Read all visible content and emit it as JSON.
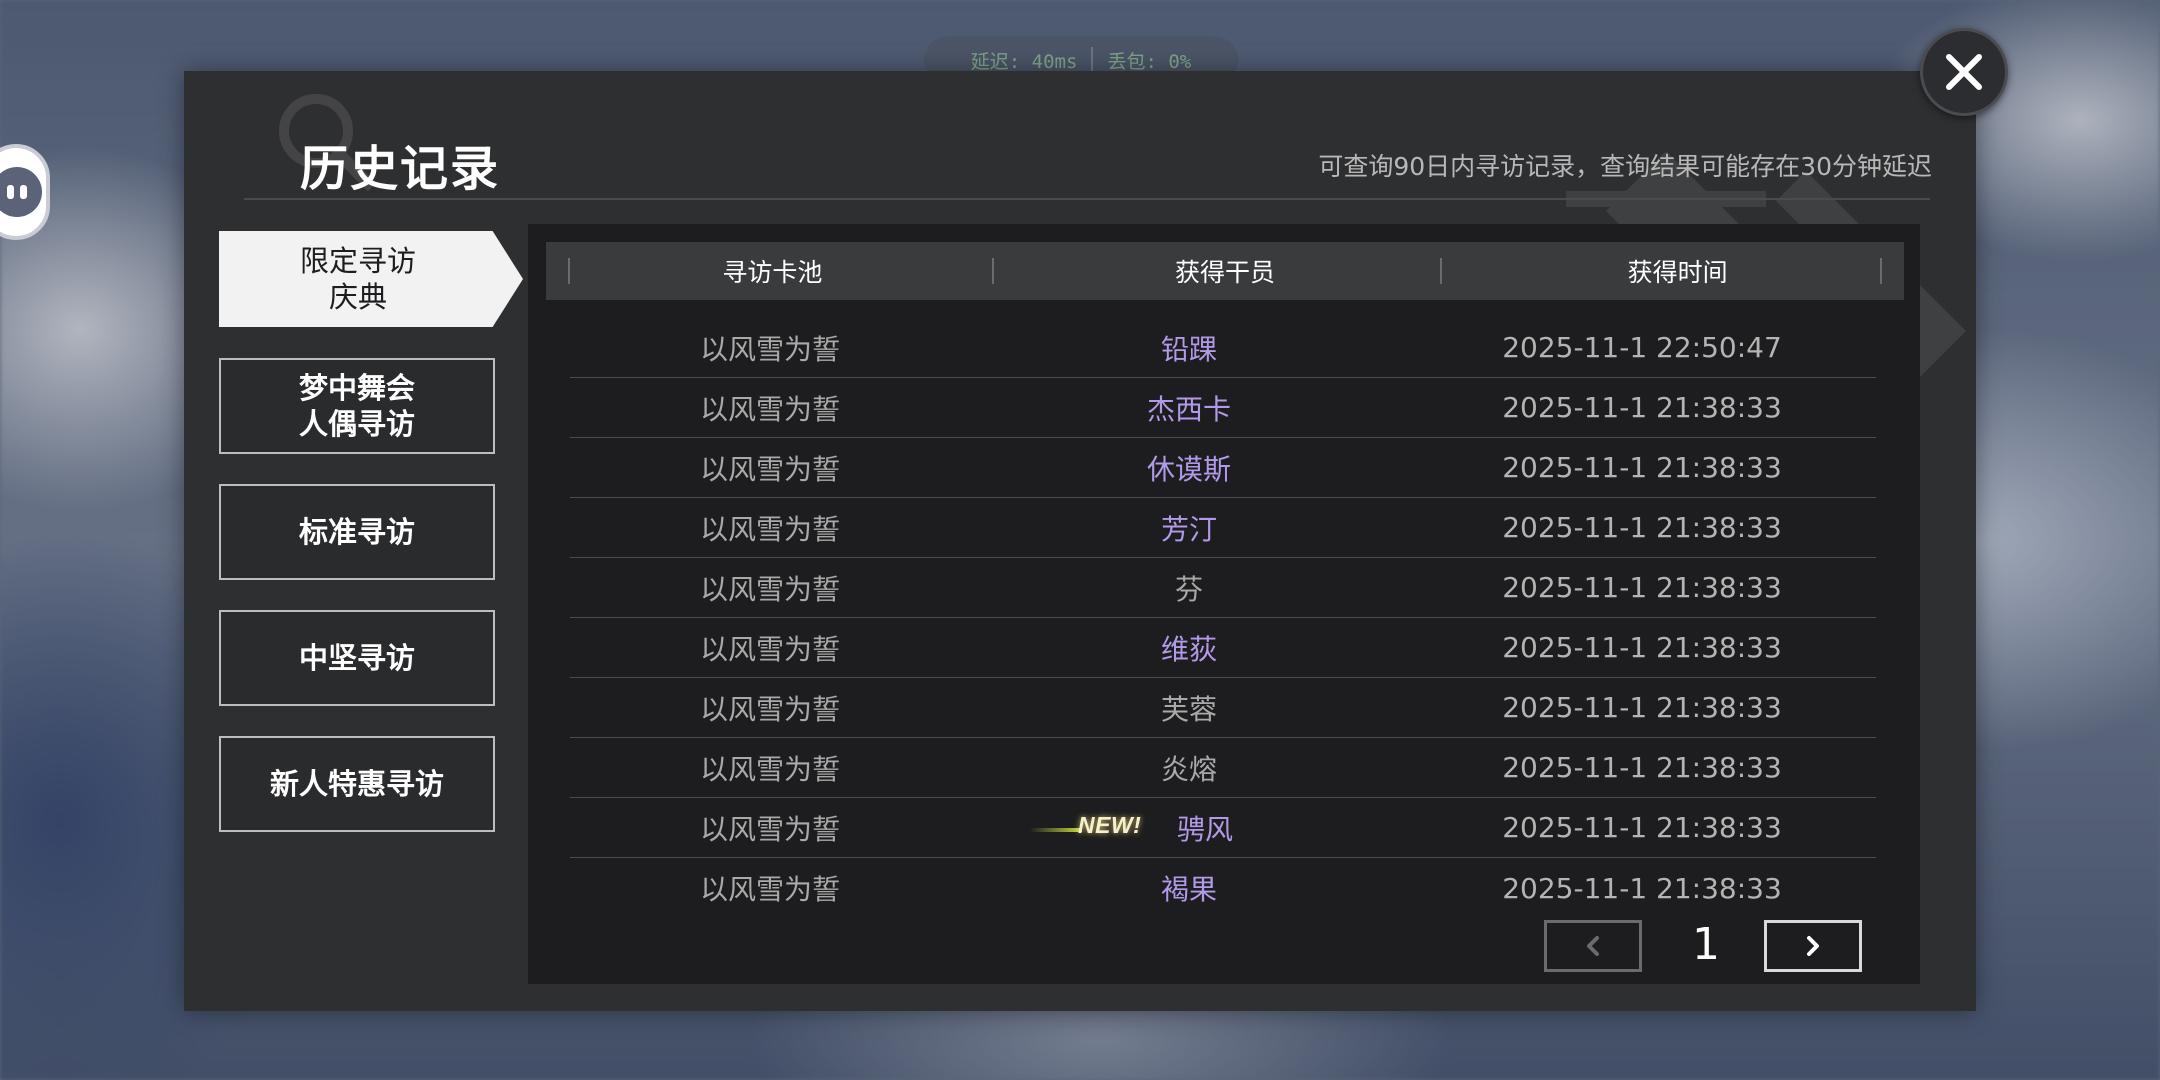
{
  "status": {
    "latency": "延迟: 40ms",
    "packet_loss": "丢包: 0%"
  },
  "panel": {
    "title": "历史记录",
    "subtitle": "可查询90日内寻访记录，查询结果可能存在30分钟延迟"
  },
  "tabs": [
    {
      "label_line1": "限定寻访",
      "label_line2": "庆典",
      "active": true
    },
    {
      "label_line1": "梦中舞会",
      "label_line2": "人偶寻访",
      "active": false
    },
    {
      "label_line1": "标准寻访",
      "label_line2": "",
      "active": false
    },
    {
      "label_line1": "中坚寻访",
      "label_line2": "",
      "active": false
    },
    {
      "label_line1": "新人特惠寻访",
      "label_line2": "",
      "active": false
    }
  ],
  "table": {
    "headers": [
      "寻访卡池",
      "获得干员",
      "获得时间"
    ],
    "rows": [
      {
        "pool": "以风雪为誓",
        "operator": "铅踝",
        "time": "2025-11-1 22:50:47",
        "rarity": "high",
        "new": false
      },
      {
        "pool": "以风雪为誓",
        "operator": "杰西卡",
        "time": "2025-11-1 21:38:33",
        "rarity": "high",
        "new": false
      },
      {
        "pool": "以风雪为誓",
        "operator": "休谟斯",
        "time": "2025-11-1 21:38:33",
        "rarity": "high",
        "new": false
      },
      {
        "pool": "以风雪为誓",
        "operator": "芳汀",
        "time": "2025-11-1 21:38:33",
        "rarity": "high",
        "new": false
      },
      {
        "pool": "以风雪为誓",
        "operator": "芬",
        "time": "2025-11-1 21:38:33",
        "rarity": "low",
        "new": false
      },
      {
        "pool": "以风雪为誓",
        "operator": "维荻",
        "time": "2025-11-1 21:38:33",
        "rarity": "high",
        "new": false
      },
      {
        "pool": "以风雪为誓",
        "operator": "芙蓉",
        "time": "2025-11-1 21:38:33",
        "rarity": "low",
        "new": false
      },
      {
        "pool": "以风雪为誓",
        "operator": "炎熔",
        "time": "2025-11-1 21:38:33",
        "rarity": "low",
        "new": false
      },
      {
        "pool": "以风雪为誓",
        "operator": "骋风",
        "time": "2025-11-1 21:38:33",
        "rarity": "high",
        "new": true
      },
      {
        "pool": "以风雪为誓",
        "operator": "褐果",
        "time": "2025-11-1 21:38:33",
        "rarity": "high",
        "new": false
      }
    ],
    "new_badge_label": "NEW!"
  },
  "pagination": {
    "current_page": "1",
    "prev_icon": "chevron-left-icon",
    "next_icon": "chevron-right-icon"
  },
  "colors": {
    "panel_bg": "#2e2f31",
    "table_bg": "#1d1d1f",
    "high_rarity_text": "#b29ae8",
    "low_rarity_text": "#a9a9a9",
    "active_tab_bg": "#f2f2f2"
  }
}
